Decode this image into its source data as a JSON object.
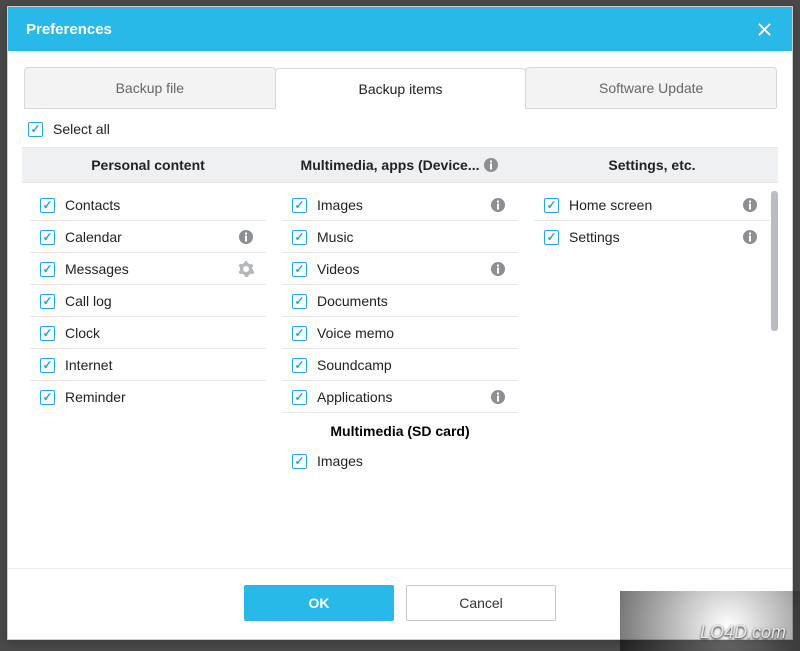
{
  "window": {
    "title": "Preferences"
  },
  "tabs": [
    {
      "label": "Backup file",
      "active": false
    },
    {
      "label": "Backup items",
      "active": true
    },
    {
      "label": "Software Update",
      "active": false
    }
  ],
  "select_all": {
    "label": "Select all",
    "checked": true
  },
  "columns": [
    {
      "header": "Personal content",
      "header_info": false,
      "items": [
        {
          "label": "Contacts",
          "checked": true
        },
        {
          "label": "Calendar",
          "checked": true,
          "info": true
        },
        {
          "label": "Messages",
          "checked": true,
          "gear": true
        },
        {
          "label": "Call log",
          "checked": true
        },
        {
          "label": "Clock",
          "checked": true
        },
        {
          "label": "Internet",
          "checked": true
        },
        {
          "label": "Reminder",
          "checked": true
        }
      ]
    },
    {
      "header": "Multimedia, apps (Device...",
      "header_info": true,
      "items": [
        {
          "label": "Images",
          "checked": true,
          "info": true
        },
        {
          "label": "Music",
          "checked": true
        },
        {
          "label": "Videos",
          "checked": true,
          "info": true
        },
        {
          "label": "Documents",
          "checked": true
        },
        {
          "label": "Voice memo",
          "checked": true
        },
        {
          "label": "Soundcamp",
          "checked": true
        },
        {
          "label": "Applications",
          "checked": true,
          "info": true
        }
      ],
      "subheader": "Multimedia (SD card)",
      "sub_items": [
        {
          "label": "Images",
          "checked": true
        }
      ]
    },
    {
      "header": "Settings, etc.",
      "header_info": false,
      "items": [
        {
          "label": "Home screen",
          "checked": true,
          "info": true
        },
        {
          "label": "Settings",
          "checked": true,
          "info": true
        }
      ]
    }
  ],
  "footer": {
    "ok": "OK",
    "cancel": "Cancel"
  },
  "watermark": "LO4D.com"
}
